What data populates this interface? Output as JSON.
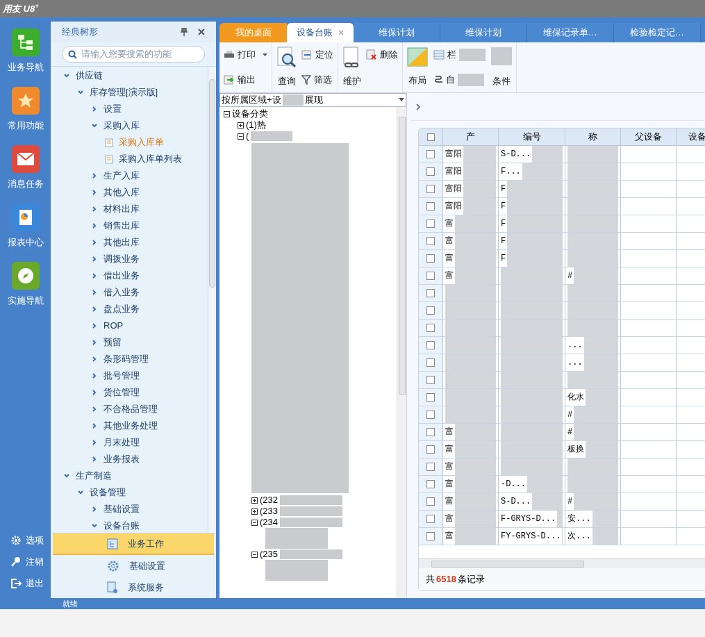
{
  "window": {
    "title": "用友 U8",
    "title_sup": "+"
  },
  "nav": [
    {
      "label": "业务导航",
      "kind": "tree"
    },
    {
      "label": "常用功能",
      "kind": "star"
    },
    {
      "label": "消息任务",
      "kind": "mail"
    },
    {
      "label": "报表中心",
      "kind": "report"
    },
    {
      "label": "实施导航",
      "kind": "compass"
    }
  ],
  "nav_bottom": [
    {
      "label": "选项",
      "kind": "gear"
    },
    {
      "label": "注销",
      "kind": "key"
    },
    {
      "label": "退出",
      "kind": "exit"
    }
  ],
  "tree_panel": {
    "title": "经典树形",
    "search_placeholder": "请输入您要搜索的功能",
    "items": [
      {
        "label": "供应链",
        "expanded": true,
        "children": [
          {
            "label": "库存管理[演示版]",
            "expanded": true,
            "children": [
              {
                "label": "设置",
                "expanded": false
              },
              {
                "label": "采购入库",
                "expanded": true,
                "children": [
                  {
                    "label": "采购入库单",
                    "selected": true
                  },
                  {
                    "label": "采购入库单列表",
                    "selected": false
                  }
                ]
              },
              {
                "label": "生产入库",
                "expanded": false
              },
              {
                "label": "其他入库",
                "expanded": false
              },
              {
                "label": "材料出库",
                "expanded": false
              },
              {
                "label": "销售出库",
                "expanded": false
              },
              {
                "label": "其他出库",
                "expanded": false
              },
              {
                "label": "调拨业务",
                "expanded": false
              },
              {
                "label": "借出业务",
                "expanded": false
              },
              {
                "label": "借入业务",
                "expanded": false
              },
              {
                "label": "盘点业务",
                "expanded": false
              },
              {
                "label": "ROP",
                "expanded": false
              },
              {
                "label": "预留",
                "expanded": false
              },
              {
                "label": "条形码管理",
                "expanded": false
              },
              {
                "label": "批号管理",
                "expanded": false
              },
              {
                "label": "货位管理",
                "expanded": false
              },
              {
                "label": "不合格品管理",
                "expanded": false
              },
              {
                "label": "其他业务处理",
                "expanded": false
              },
              {
                "label": "月末处理",
                "expanded": false
              },
              {
                "label": "业务报表",
                "expanded": false
              }
            ]
          }
        ]
      },
      {
        "label": "生产制造",
        "expanded": true,
        "children": [
          {
            "label": "设备管理",
            "expanded": true,
            "children": [
              {
                "label": "基础设置",
                "expanded": false
              },
              {
                "label": "设备台账",
                "expanded": true
              }
            ]
          }
        ]
      }
    ],
    "sections": [
      {
        "label": "业务工作",
        "kind": "work",
        "selected": true
      },
      {
        "label": "基础设置",
        "kind": "gear",
        "selected": false
      },
      {
        "label": "系统服务",
        "kind": "service",
        "selected": false
      }
    ]
  },
  "tabs": [
    {
      "label": "我的桌面",
      "kind": "home",
      "selected": false
    },
    {
      "label": "设备台账",
      "kind": "doc",
      "selected": true,
      "closable": true
    },
    {
      "label": "维保计划",
      "kind": "doc",
      "selected": false
    },
    {
      "label": "维保计划",
      "kind": "doc",
      "selected": false
    },
    {
      "label": "维保记录单…",
      "kind": "doc",
      "selected": false
    },
    {
      "label": "检验检定记…",
      "kind": "doc",
      "selected": false
    }
  ],
  "toolbar": {
    "print": "打印",
    "export": "输出",
    "query": "查询",
    "locate": "定位",
    "filter": "筛选",
    "maintain": "维护",
    "delete": "删除",
    "layout": "布局",
    "columns": "栏",
    "auto": "自",
    "condition": "条件"
  },
  "view_select": {
    "value_start": "按所属区域+设",
    "value_end": "展现"
  },
  "category_tree": {
    "root": "设备分类",
    "root_expanded": true,
    "upper_items": [
      {
        "label": "(1)热",
        "expanded": false
      },
      {
        "label": "(",
        "expanded": true
      }
    ],
    "lower_items": [
      {
        "label": "(232",
        "expanded": false
      },
      {
        "label": "(233",
        "expanded": false
      },
      {
        "label": "(234",
        "expanded": true
      },
      {
        "label": "(235",
        "expanded": true
      }
    ]
  },
  "table": {
    "all_checked": false,
    "columns": [
      "产",
      "编号",
      "称",
      "父设备",
      "设备"
    ],
    "rows": [
      {
        "checked": false,
        "column_1": "富阳",
        "column_2": "S-D..."
      },
      {
        "checked": false,
        "column_1": "富阳",
        "column_2": "F..."
      },
      {
        "checked": false,
        "column_1": "富阳",
        "column_2": "F"
      },
      {
        "checked": false,
        "column_1": "富阳",
        "column_2": "F"
      },
      {
        "checked": false,
        "column_1": "富",
        "column_2": "F"
      },
      {
        "checked": false,
        "column_1": "富",
        "column_2": "F"
      },
      {
        "checked": false,
        "column_1": "富",
        "column_2": "F"
      },
      {
        "checked": false,
        "column_1": "富",
        "column_3": "#"
      },
      {
        "checked": false
      },
      {
        "checked": false
      },
      {
        "checked": false
      },
      {
        "checked": false,
        "column_3": "..."
      },
      {
        "checked": false,
        "column_3": "..."
      },
      {
        "checked": false
      },
      {
        "checked": false,
        "column_3": "化水"
      },
      {
        "checked": false,
        "column_3": "#"
      },
      {
        "checked": false,
        "column_1": "富",
        "column_3": "#"
      },
      {
        "checked": false,
        "column_1": "富",
        "column_3": "板换"
      },
      {
        "checked": false,
        "column_1": "富"
      },
      {
        "checked": false,
        "column_1": "富",
        "column_2": "-D..."
      },
      {
        "checked": false,
        "column_1": "富",
        "column_2": "S-D...",
        "column_3": "#"
      },
      {
        "checked": false,
        "column_1": "富",
        "column_2": "F-GRYS-D...",
        "column_3": "安..."
      },
      {
        "checked": false,
        "column_1": "富",
        "column_2": "FY-GRYS-D...",
        "column_3": "次..."
      }
    ],
    "footer_prefix": "共",
    "record_count": "6518",
    "footer_suffix": "条记录"
  },
  "status_bar": {
    "text": "就绪"
  }
}
